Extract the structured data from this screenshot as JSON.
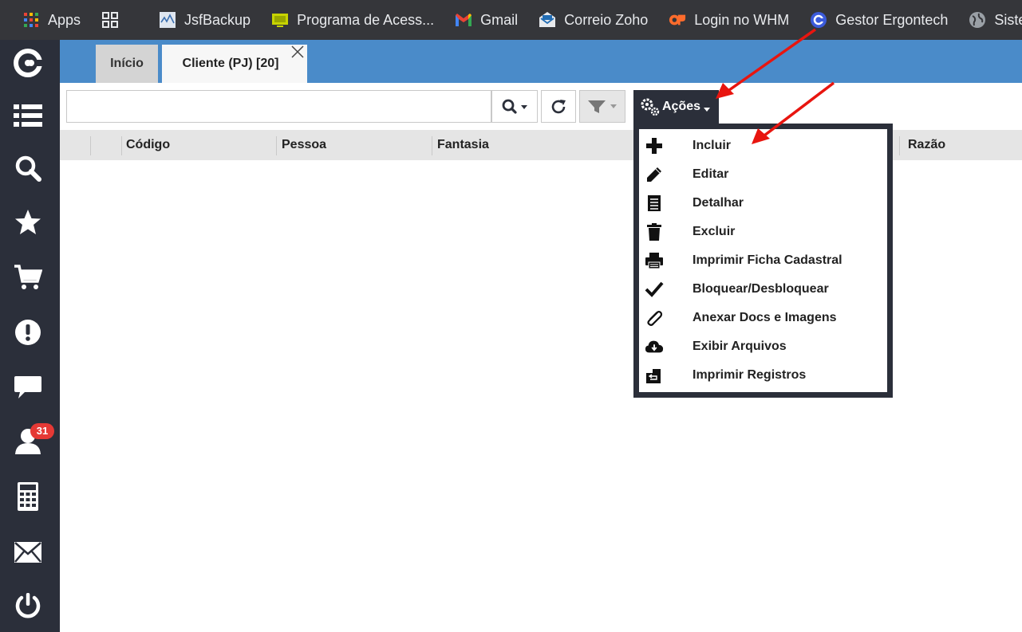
{
  "bookmarks": [
    {
      "name": "apps",
      "label": "Apps",
      "icon": "apps-grid-icon"
    },
    {
      "name": "grid",
      "label": "",
      "icon": "tab-grid-icon"
    },
    {
      "name": "jsfbackup",
      "label": "JsfBackup",
      "icon": "jsfbackup-icon"
    },
    {
      "name": "programa",
      "label": "Programa de Acess...",
      "icon": "screen-icon"
    },
    {
      "name": "gmail",
      "label": "Gmail",
      "icon": "gmail-icon"
    },
    {
      "name": "zoho",
      "label": "Correio Zoho",
      "icon": "zoho-mail-icon"
    },
    {
      "name": "whm",
      "label": "Login no WHM",
      "icon": "cpanel-icon"
    },
    {
      "name": "ergontech",
      "label": "Gestor Ergontech",
      "icon": "ergontech-icon"
    },
    {
      "name": "sistem",
      "label": "Sistem",
      "icon": "globe-icon"
    }
  ],
  "sidebar": {
    "icons": [
      "logo-icon",
      "list-icon",
      "search-icon",
      "star-icon",
      "cart-icon",
      "alert-icon",
      "chat-icon",
      "user-icon",
      "calculator-icon",
      "mail-icon",
      "power-icon"
    ],
    "badge": "31"
  },
  "tabs": {
    "inicio": "Início",
    "cliente": "Cliente (PJ) [20]",
    "close": "×"
  },
  "toolbar": {
    "search_value": "",
    "acoes_label": "Ações"
  },
  "grid": {
    "columns": [
      "Código",
      "Pessoa",
      "Fantasia",
      "Razão"
    ]
  },
  "menu": {
    "items": [
      {
        "label": "Incluir",
        "icon": "plus-icon"
      },
      {
        "label": "Editar",
        "icon": "pencil-icon"
      },
      {
        "label": "Detalhar",
        "icon": "document-icon"
      },
      {
        "label": "Excluir",
        "icon": "trash-icon"
      },
      {
        "label": "Imprimir Ficha Cadastral",
        "icon": "printer-icon"
      },
      {
        "label": "Bloquear/Desbloquear",
        "icon": "check-icon"
      },
      {
        "label": "Anexar Docs e Imagens",
        "icon": "paperclip-icon"
      },
      {
        "label": "Exibir Arquivos",
        "icon": "cloud-download-icon"
      },
      {
        "label": "Imprimir Registros",
        "icon": "print-records-icon"
      }
    ]
  },
  "colors": {
    "sidebar": "#2b2f3a",
    "tabbar": "#4a8bc9",
    "annotation_arrow": "#e8150f"
  }
}
